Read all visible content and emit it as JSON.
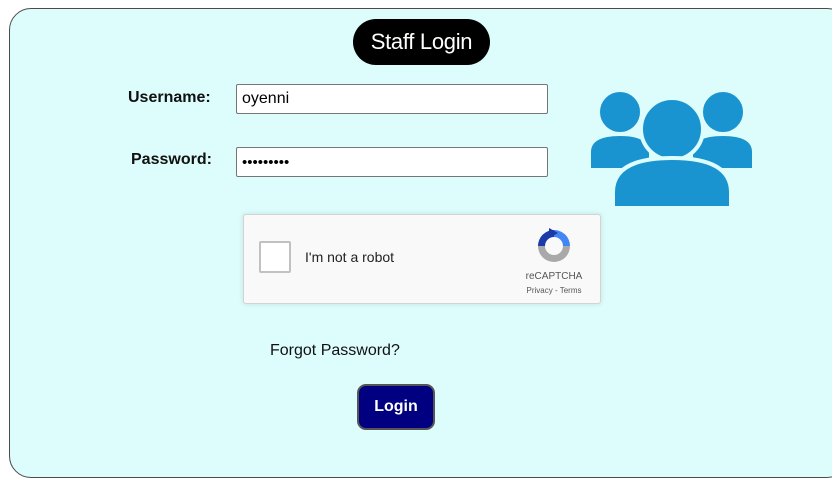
{
  "form": {
    "title": "Staff Login",
    "username_label": "Username:",
    "username_value": "oyenni",
    "password_label": "Password:",
    "password_value": "oyenni123",
    "forgot_link": "Forgot Password?",
    "login_button": "Login"
  },
  "captcha": {
    "checkbox_label": "I'm not a robot",
    "brand": "reCAPTCHA",
    "privacy_link": "Privacy",
    "separator": " - ",
    "terms_link": "Terms"
  },
  "colors": {
    "panel_background": "#dcfdfc",
    "title_background": "#000000",
    "login_button_background": "#000080",
    "users_icon": "#1a94d0"
  },
  "icons": {
    "users": "users-group-icon",
    "captcha": "recaptcha-logo-icon"
  }
}
